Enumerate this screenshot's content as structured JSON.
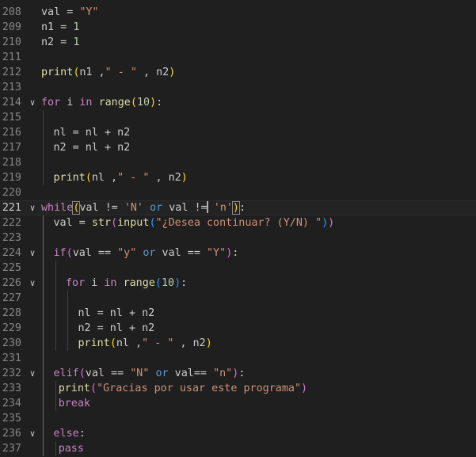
{
  "editor": {
    "language": "python",
    "theme": "dark",
    "current_line": "221",
    "lines": [
      {
        "number": "208",
        "tokens": [
          {
            "t": "val = ",
            "c": "v"
          },
          {
            "t": "\"Y\"",
            "c": "s"
          }
        ]
      },
      {
        "number": "209",
        "tokens": [
          {
            "t": "n1 = ",
            "c": "v"
          },
          {
            "t": "1",
            "c": "n"
          }
        ]
      },
      {
        "number": "210",
        "tokens": [
          {
            "t": "n2 = ",
            "c": "v"
          },
          {
            "t": "1",
            "c": "n"
          }
        ]
      },
      {
        "number": "211",
        "tokens": []
      },
      {
        "number": "212",
        "tokens": [
          {
            "t": "print",
            "c": "f"
          },
          {
            "t": "(",
            "c": "p1"
          },
          {
            "t": "n1 ,",
            "c": "v"
          },
          {
            "t": "\" - \"",
            "c": "s"
          },
          {
            "t": " , n2",
            "c": "v"
          },
          {
            "t": ")",
            "c": "p1"
          }
        ]
      },
      {
        "number": "213",
        "tokens": []
      },
      {
        "number": "214",
        "fold": true,
        "tokens": [
          {
            "t": "for",
            "c": "k"
          },
          {
            "t": " i ",
            "c": "v"
          },
          {
            "t": "in",
            "c": "k"
          },
          {
            "t": " ",
            "c": "v"
          },
          {
            "t": "range",
            "c": "f"
          },
          {
            "t": "(",
            "c": "p1"
          },
          {
            "t": "10",
            "c": "n"
          },
          {
            "t": ")",
            "c": "p1"
          },
          {
            "t": ":",
            "c": "v"
          }
        ]
      },
      {
        "number": "215",
        "tokens": []
      },
      {
        "number": "216",
        "indent": 1,
        "tokens": [
          {
            "t": "nl = nl + n2",
            "c": "v"
          }
        ]
      },
      {
        "number": "217",
        "indent": 1,
        "tokens": [
          {
            "t": "n2 = nl + n2",
            "c": "v"
          }
        ]
      },
      {
        "number": "218",
        "tokens": []
      },
      {
        "number": "219",
        "indent": 1,
        "tokens": [
          {
            "t": "print",
            "c": "f"
          },
          {
            "t": "(",
            "c": "p1"
          },
          {
            "t": "nl ,",
            "c": "v"
          },
          {
            "t": "\" - \"",
            "c": "s"
          },
          {
            "t": " , n2",
            "c": "v"
          },
          {
            "t": ")",
            "c": "p1"
          }
        ]
      },
      {
        "number": "220",
        "tokens": []
      },
      {
        "number": "221",
        "fold": true,
        "tokens": [
          {
            "t": "while",
            "c": "k"
          },
          {
            "t": "(",
            "c": "p1 bm"
          },
          {
            "t": "val != ",
            "c": "v"
          },
          {
            "t": "'N'",
            "c": "s"
          },
          {
            "t": " ",
            "c": "v"
          },
          {
            "t": "or",
            "c": "b"
          },
          {
            "t": " val !=",
            "c": "v"
          },
          {
            "t": "",
            "c": "cursor"
          },
          {
            "t": " ",
            "c": "v"
          },
          {
            "t": "'n'",
            "c": "s"
          },
          {
            "t": ")",
            "c": "p1 bm"
          },
          {
            "t": ":",
            "c": "v"
          }
        ]
      },
      {
        "number": "222",
        "indent": 1,
        "tokens": [
          {
            "t": "val = ",
            "c": "v"
          },
          {
            "t": "str",
            "c": "f"
          },
          {
            "t": "(",
            "c": "p2"
          },
          {
            "t": "input",
            "c": "f"
          },
          {
            "t": "(",
            "c": "p3"
          },
          {
            "t": "\"¿Desea continuar? (Y/N) \"",
            "c": "s"
          },
          {
            "t": ")",
            "c": "p3"
          },
          {
            "t": ")",
            "c": "p2"
          }
        ]
      },
      {
        "number": "223",
        "tokens": []
      },
      {
        "number": "224",
        "indent": 1,
        "fold": true,
        "tokens": [
          {
            "t": "if",
            "c": "k"
          },
          {
            "t": "(",
            "c": "p2"
          },
          {
            "t": "val == ",
            "c": "v"
          },
          {
            "t": "\"y\"",
            "c": "s"
          },
          {
            "t": " ",
            "c": "v"
          },
          {
            "t": "or",
            "c": "b"
          },
          {
            "t": " val == ",
            "c": "v"
          },
          {
            "t": "\"Y\"",
            "c": "s"
          },
          {
            "t": ")",
            "c": "p2"
          },
          {
            "t": ":",
            "c": "v"
          }
        ]
      },
      {
        "number": "225",
        "tokens": []
      },
      {
        "number": "226",
        "indent": 2,
        "fold": true,
        "tokens": [
          {
            "t": "for",
            "c": "k"
          },
          {
            "t": " i ",
            "c": "v"
          },
          {
            "t": "in",
            "c": "k"
          },
          {
            "t": " ",
            "c": "v"
          },
          {
            "t": "range",
            "c": "f"
          },
          {
            "t": "(",
            "c": "p3"
          },
          {
            "t": "10",
            "c": "n"
          },
          {
            "t": ")",
            "c": "p3"
          },
          {
            "t": ":",
            "c": "v"
          }
        ]
      },
      {
        "number": "227",
        "tokens": []
      },
      {
        "number": "228",
        "indent": 3,
        "tokens": [
          {
            "t": "nl = nl + n2",
            "c": "v"
          }
        ]
      },
      {
        "number": "229",
        "indent": 3,
        "tokens": [
          {
            "t": "n2 = nl + n2",
            "c": "v"
          }
        ]
      },
      {
        "number": "230",
        "indent": 3,
        "tokens": [
          {
            "t": "print",
            "c": "f"
          },
          {
            "t": "(",
            "c": "p1"
          },
          {
            "t": "nl ,",
            "c": "v"
          },
          {
            "t": "\" - \"",
            "c": "s"
          },
          {
            "t": " , n2",
            "c": "v"
          },
          {
            "t": ")",
            "c": "p1"
          }
        ]
      },
      {
        "number": "231",
        "tokens": []
      },
      {
        "number": "232",
        "indent": 1,
        "fold": true,
        "tokens": [
          {
            "t": "elif",
            "c": "k"
          },
          {
            "t": "(",
            "c": "p2"
          },
          {
            "t": "val == ",
            "c": "v"
          },
          {
            "t": "\"N\"",
            "c": "s"
          },
          {
            "t": " ",
            "c": "v"
          },
          {
            "t": "or",
            "c": "b"
          },
          {
            "t": " val== ",
            "c": "v"
          },
          {
            "t": "\"n\"",
            "c": "s"
          },
          {
            "t": ")",
            "c": "p2"
          },
          {
            "t": ":",
            "c": "v"
          }
        ]
      },
      {
        "number": "233",
        "indent": 1.4,
        "tokens": [
          {
            "t": "print",
            "c": "f"
          },
          {
            "t": "(",
            "c": "p2"
          },
          {
            "t": "\"Gracias por usar este programa\"",
            "c": "s"
          },
          {
            "t": ")",
            "c": "p2"
          }
        ]
      },
      {
        "number": "234",
        "indent": 1.4,
        "tokens": [
          {
            "t": "break",
            "c": "k"
          }
        ]
      },
      {
        "number": "235",
        "tokens": []
      },
      {
        "number": "236",
        "indent": 1,
        "fold": true,
        "tokens": [
          {
            "t": "else",
            "c": "k"
          },
          {
            "t": ":",
            "c": "v"
          }
        ]
      },
      {
        "number": "237",
        "indent": 1.4,
        "tokens": [
          {
            "t": "pass",
            "c": "k"
          }
        ]
      }
    ]
  }
}
